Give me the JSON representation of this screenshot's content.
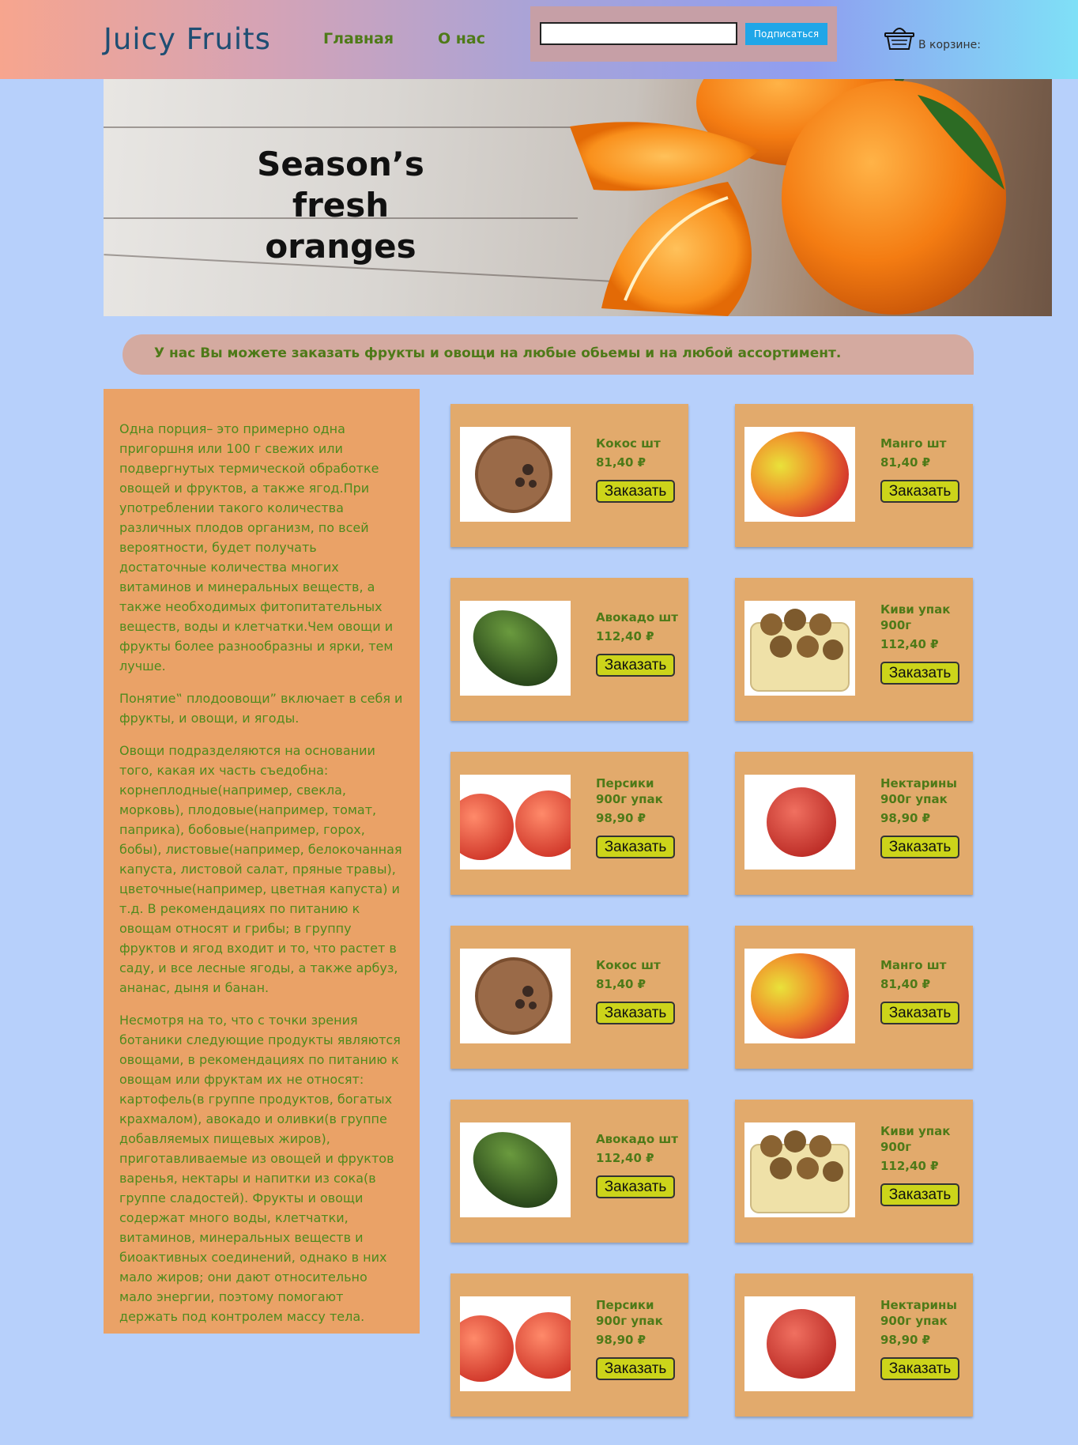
{
  "header": {
    "logo": "Juicy Fruits",
    "nav": [
      {
        "label": "Главная"
      },
      {
        "label": "О нас"
      }
    ],
    "subscribe": {
      "input_value": "",
      "button_label": "Подписаться"
    },
    "cart": {
      "icon": "basket-icon",
      "label": "В корзине:"
    }
  },
  "banner": {
    "title_line1": "Season’s",
    "title_line2": "fresh oranges"
  },
  "info_strip": {
    "text": "У нас Вы можете заказать фрукты и овощи на любые обьемы и на любой ассортимент."
  },
  "article": {
    "paragraphs": [
      "Одна порция– это примерно одна пригоршня или 100 г свежих или подвергнутых термической обработке овощей и фруктов, а также ягод.При употреблении такого количества различных плодов организм, по всей вероятности, будет получать достаточные количества многих витаминов и минеральных веществ, а также необходимых фитопитательных веществ, воды и клетчатки.Чем овощи и фрукты более разнообразны и ярки, тем лучше.",
      "Понятие‟ плодоовощи” включает в себя и фрукты, и овощи, и ягоды.",
      "Овощи подразделяются на основании того, какая их часть съедобна: корнеплодные(например, свекла, морковь), плодовые(например, томат, паприка), бобовые(например, горох, бобы), листовые(например, белокочанная капуста, листовой салат, пряные травы), цветочные(например, цветная капуста) и т.д. В рекомендациях по питанию к овощам относят и грибы; в группу фруктов и ягод входит и то, что растет в саду, и все лесные ягоды, а также арбуз, ананас, дыня и банан.",
      "Несмотря на то, что с точки зрения ботаники следующие продукты являются овощами, в рекомендациях по питанию к овощам или фруктам их не относят: картофель(в группе продуктов, богатых крахмалом), авокадо и оливки(в группе добавляемых пищевых жиров), приготавливаемые из овощей и фруктов варенья, нектары и напитки из сока(в группе сладостей). Фрукты и овощи содержат много воды, клетчатки, витаминов, минеральных веществ и биоактивных соединений, однако в них мало жиров; они дают относительно мало энергии, поэтому помогают держать под контролем массу тела."
    ]
  },
  "order_label": "Заказать",
  "products": [
    {
      "name": "Кокос шт",
      "price": "81,40 ₽",
      "image": "coconut"
    },
    {
      "name": "Манго шт",
      "price": "81,40 ₽",
      "image": "mango"
    },
    {
      "name": "Авокадо шт",
      "price": "112,40 ₽",
      "image": "avocado"
    },
    {
      "name": "Киви упак 900г",
      "price": "112,40 ₽",
      "image": "kiwi"
    },
    {
      "name": "Персики 900г упак",
      "price": "98,90 ₽",
      "image": "peaches"
    },
    {
      "name": "Нектарины 900г упак",
      "price": "98,90 ₽",
      "image": "nectarine"
    },
    {
      "name": "Кокос шт",
      "price": "81,40 ₽",
      "image": "coconut"
    },
    {
      "name": "Манго шт",
      "price": "81,40 ₽",
      "image": "mango"
    },
    {
      "name": "Авокадо шт",
      "price": "112,40 ₽",
      "image": "avocado"
    },
    {
      "name": "Киви упак 900г",
      "price": "112,40 ₽",
      "image": "kiwi"
    },
    {
      "name": "Персики 900г упак",
      "price": "98,90 ₽",
      "image": "peaches"
    },
    {
      "name": "Нектарины 900г упак",
      "price": "98,90 ₽",
      "image": "nectarine"
    }
  ]
}
